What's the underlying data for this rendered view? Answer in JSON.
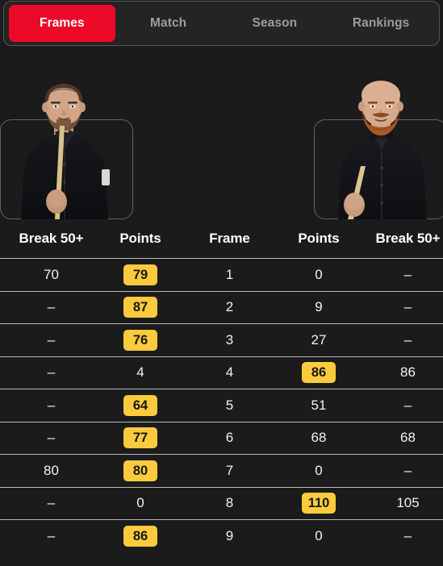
{
  "tabs": [
    {
      "label": "Frames",
      "active": true
    },
    {
      "label": "Match",
      "active": false
    },
    {
      "label": "Season",
      "active": false
    },
    {
      "label": "Rankings",
      "active": false
    }
  ],
  "players": {
    "left": {
      "photo": "player-photo-left",
      "description": "snooker player holding cue, short hair, beard, black shirt"
    },
    "right": {
      "photo": "player-photo-right",
      "description": "snooker player holding cue, bald, red beard, black shirt with bow tie"
    }
  },
  "table": {
    "headers": {
      "left_break": "Break 50+",
      "left_points": "Points",
      "frame": "Frame",
      "right_points": "Points",
      "right_break": "Break 50+"
    },
    "rows": [
      {
        "left_break": "70",
        "left_points": "79",
        "left_highlight": true,
        "frame": "1",
        "right_points": "0",
        "right_highlight": false,
        "right_break": "–"
      },
      {
        "left_break": "–",
        "left_points": "87",
        "left_highlight": true,
        "frame": "2",
        "right_points": "9",
        "right_highlight": false,
        "right_break": "–"
      },
      {
        "left_break": "–",
        "left_points": "76",
        "left_highlight": true,
        "frame": "3",
        "right_points": "27",
        "right_highlight": false,
        "right_break": "–"
      },
      {
        "left_break": "–",
        "left_points": "4",
        "left_highlight": false,
        "frame": "4",
        "right_points": "86",
        "right_highlight": true,
        "right_break": "86"
      },
      {
        "left_break": "–",
        "left_points": "64",
        "left_highlight": true,
        "frame": "5",
        "right_points": "51",
        "right_highlight": false,
        "right_break": "–"
      },
      {
        "left_break": "–",
        "left_points": "77",
        "left_highlight": true,
        "frame": "6",
        "right_points": "68",
        "right_highlight": false,
        "right_break": "68"
      },
      {
        "left_break": "80",
        "left_points": "80",
        "left_highlight": true,
        "frame": "7",
        "right_points": "0",
        "right_highlight": false,
        "right_break": "–"
      },
      {
        "left_break": "–",
        "left_points": "0",
        "left_highlight": false,
        "frame": "8",
        "right_points": "110",
        "right_highlight": true,
        "right_break": "105"
      },
      {
        "left_break": "–",
        "left_points": "86",
        "left_highlight": true,
        "frame": "9",
        "right_points": "0",
        "right_highlight": false,
        "right_break": "–"
      }
    ]
  },
  "colors": {
    "background": "#1b1b1b",
    "tabbar_background": "#242424",
    "active_tab": "#ec0928",
    "badge": "#fbcb3d",
    "badge_text": "#171717",
    "row_separator": "#b9b9b9",
    "text": "#f2f2f2",
    "inactive_tab_text": "#9c9c9c"
  }
}
